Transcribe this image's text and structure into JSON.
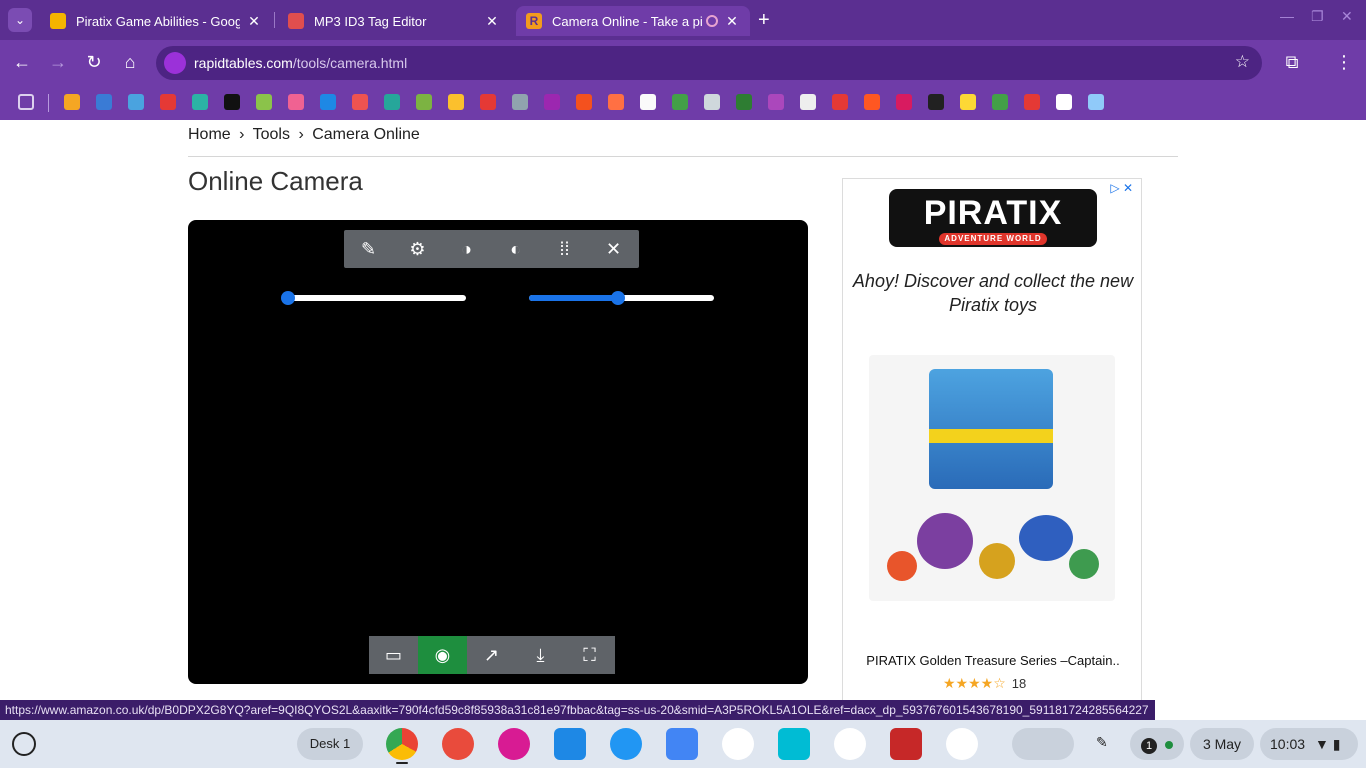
{
  "browser": {
    "tabs": [
      {
        "title": "Piratix Game Abilities - Google",
        "close": "✕"
      },
      {
        "title": "MP3 ID3 Tag Editor",
        "close": "✕"
      },
      {
        "title": "Camera Online - Take a pict",
        "close": "✕"
      }
    ],
    "newtab": "+",
    "url_domain": "rapidtables.com",
    "url_path": "/tools/camera.html"
  },
  "page": {
    "breadcrumb": [
      "Home",
      "›",
      "Tools",
      "›",
      "Camera Online"
    ],
    "title": "Online Camera"
  },
  "camera": {
    "sliders": [
      {
        "name": "left-slider",
        "fill": 0.0
      },
      {
        "name": "right-slider",
        "fill": 0.48
      }
    ]
  },
  "ad": {
    "logo": "PIRATIX",
    "logo_sub": "ADVENTURE WORLD",
    "tagline": "Ahoy! Discover and collect the new Piratix toys",
    "product_title": "PIRATIX Golden Treasure Series –Captain..",
    "rating": 4,
    "rating_stars": "★★★★☆",
    "rating_count": "18"
  },
  "status_url": "https://www.amazon.co.uk/dp/B0DPX2G8YQ?aref=9QI8QYOS2L&aaxitk=790f4cfd59c8f85938a31c81e97fbbac&tag=ss-us-20&smid=A3P5ROKL5A1OLE&ref=dacx_dp_593767601543678190_591181724285564227",
  "shelf": {
    "desk_label": "Desk 1",
    "notification_count": "1",
    "date": "3 May",
    "time": "10:03"
  },
  "colors": {
    "chrome_dark": "#5b2f91",
    "chrome": "#6f3ca8",
    "slider_blue": "#1a73e8",
    "capture_green": "#1e8e3e"
  }
}
